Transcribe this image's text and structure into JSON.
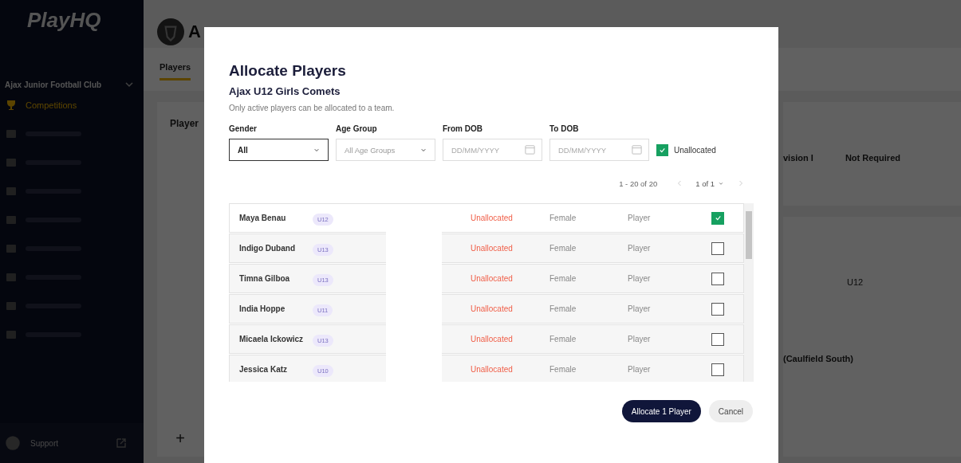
{
  "sidebar": {
    "logo": "PlayHQ",
    "org_name": "Ajax Junior Football Club",
    "items": [
      {
        "label": "Competitions",
        "selected": true
      }
    ],
    "support": "Support"
  },
  "page": {
    "title": "A",
    "tabs": [
      {
        "label": "Players",
        "selected": true
      }
    ],
    "players_card": {
      "title": "Player",
      "add_button": "+"
    },
    "details": {
      "division": "vision I",
      "player_points": "Not Required",
      "age": "U12",
      "venue": "(Caulfield South)"
    }
  },
  "modal": {
    "title": "Allocate Players",
    "subtitle": "Ajax U12 Girls Comets",
    "note": "Only active players can be allocated to a team.",
    "filters": [
      {
        "kind": "select",
        "label": "Gender",
        "value": "All"
      },
      {
        "kind": "select",
        "label": "Age Group",
        "placeholder": "All Age Groups"
      },
      {
        "kind": "date",
        "label": "From DOB",
        "placeholder": "DD/MM/YYYY"
      },
      {
        "kind": "date",
        "label": "To DOB",
        "placeholder": "DD/MM/YYYY"
      }
    ],
    "unallocated_filter": {
      "label": "Unallocated",
      "checked": true
    },
    "pagination": {
      "range": "1 - 20 of 20",
      "page": "1 of 1"
    },
    "rows": [
      {
        "name": "Maya Benau",
        "age": "U12",
        "status": "Unallocated",
        "gender": "Female",
        "role": "Player",
        "checked": true
      },
      {
        "name": "Indigo Duband",
        "age": "U13",
        "status": "Unallocated",
        "gender": "Female",
        "role": "Player",
        "checked": false
      },
      {
        "name": "Timna Gilboa",
        "age": "U13",
        "status": "Unallocated",
        "gender": "Female",
        "role": "Player",
        "checked": false
      },
      {
        "name": "India Hoppe",
        "age": "U11",
        "status": "Unallocated",
        "gender": "Female",
        "role": "Player",
        "checked": false
      },
      {
        "name": "Micaela Ickowicz",
        "age": "U13",
        "status": "Unallocated",
        "gender": "Female",
        "role": "Player",
        "checked": false
      },
      {
        "name": "Jessica Katz",
        "age": "U10",
        "status": "Unallocated",
        "gender": "Female",
        "role": "Player",
        "checked": false
      }
    ],
    "buttons": [
      {
        "kind": "primary",
        "label": "Allocate 1 Player"
      },
      {
        "kind": "secondary",
        "label": "Cancel"
      }
    ]
  }
}
